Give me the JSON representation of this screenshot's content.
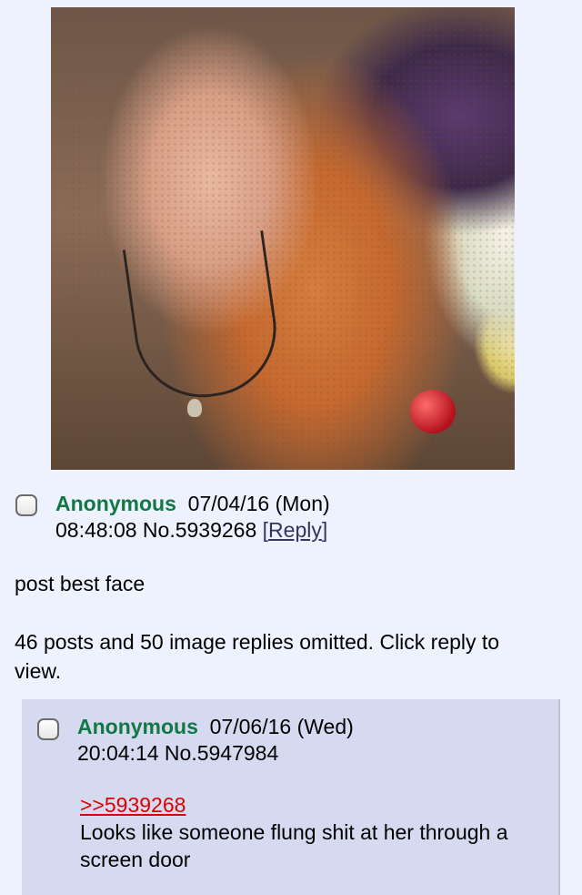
{
  "op": {
    "image_alt": "photo",
    "name": "Anonymous",
    "date": "07/04/16 (Mon)",
    "time": "08:48:08",
    "post_no": "No.5939268",
    "reply_label": "Reply",
    "bracket_open": "[",
    "bracket_close": "]",
    "comment": "post best face"
  },
  "omitted_text": "46 posts and 50 image replies omitted. Click reply to view.",
  "reply": {
    "name": "Anonymous",
    "date": "07/06/16 (Wed)",
    "time": "20:04:14",
    "post_no": "No.5947984",
    "quote": ">>5939268",
    "comment": "Looks like someone flung shit at her through a screen door"
  },
  "icons": {
    "op_checkbox": "checkbox-icon",
    "reply_checkbox": "checkbox-icon"
  },
  "colors": {
    "background": "#eef2ff",
    "reply_background": "#d6daf0",
    "name": "#117743",
    "quote_link": "#dd0000",
    "reply_link": "#34345c"
  }
}
